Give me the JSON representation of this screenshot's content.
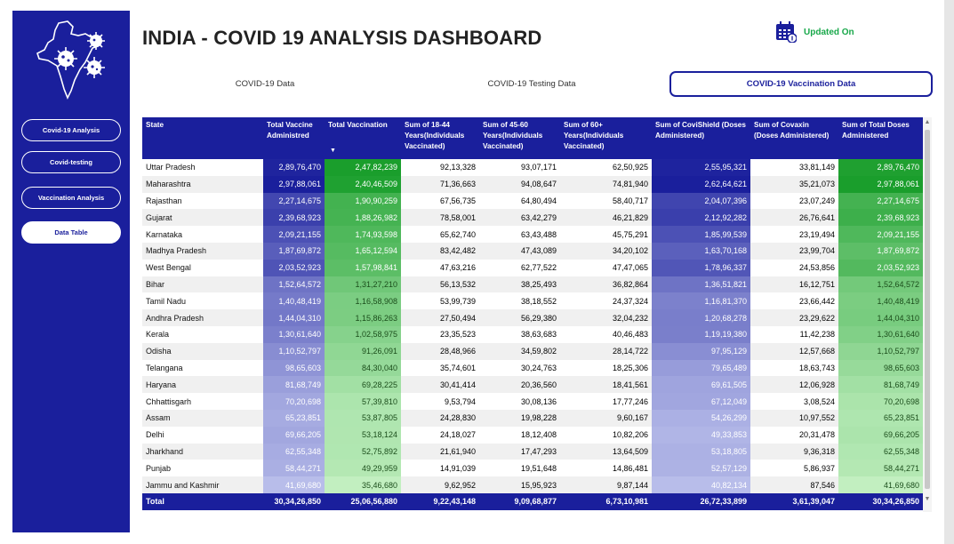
{
  "dashboard": {
    "title": "INDIA - COVID 19 ANALYSIS DASHBOARD",
    "updated_label": "Updated On",
    "calendar_icon": "calendar-icon",
    "logo_icon": "india-covid-virus-logo"
  },
  "sidebar": {
    "items": [
      {
        "label": "Covid-19 Analysis"
      },
      {
        "label": "Covid-testing"
      },
      {
        "label": "Vaccination Analysis"
      },
      {
        "label": "Data Table"
      }
    ]
  },
  "tabs": [
    {
      "label": "COVID-19 Data"
    },
    {
      "label": "COVID-19 Testing Data"
    },
    {
      "label": "COVID-19 Vaccination Data"
    }
  ],
  "table": {
    "headers": [
      "State",
      "Total Vaccine Administred",
      "Total Vaccination",
      "Sum of 18-44 Years(Individuals Vaccinated)",
      "Sum of 45-60 Years(Individuals Vaccinated)",
      "Sum of 60+ Years(Individuals Vaccinated)",
      "Sum of CoviShield (Doses Administered)",
      "Sum of Covaxin (Doses Administered)",
      "Sum of Total Doses Administered"
    ],
    "rows": [
      [
        "Uttar Pradesh",
        "2,89,76,470",
        "2,47,82,239",
        "92,13,328",
        "93,07,171",
        "62,50,925",
        "2,55,95,321",
        "33,81,149",
        "2,89,76,470"
      ],
      [
        "Maharashtra",
        "2,97,88,061",
        "2,40,46,509",
        "71,36,663",
        "94,08,647",
        "74,81,940",
        "2,62,64,621",
        "35,21,073",
        "2,97,88,061"
      ],
      [
        "Rajasthan",
        "2,27,14,675",
        "1,90,90,259",
        "67,56,735",
        "64,80,494",
        "58,40,717",
        "2,04,07,396",
        "23,07,249",
        "2,27,14,675"
      ],
      [
        "Gujarat",
        "2,39,68,923",
        "1,88,26,982",
        "78,58,001",
        "63,42,279",
        "46,21,829",
        "2,12,92,282",
        "26,76,641",
        "2,39,68,923"
      ],
      [
        "Karnataka",
        "2,09,21,155",
        "1,74,93,598",
        "65,62,740",
        "63,43,488",
        "45,75,291",
        "1,85,99,539",
        "23,19,494",
        "2,09,21,155"
      ],
      [
        "Madhya Pradesh",
        "1,87,69,872",
        "1,65,12,594",
        "83,42,482",
        "47,43,089",
        "34,20,102",
        "1,63,70,168",
        "23,99,704",
        "1,87,69,872"
      ],
      [
        "West Bengal",
        "2,03,52,923",
        "1,57,98,841",
        "47,63,216",
        "62,77,522",
        "47,47,065",
        "1,78,96,337",
        "24,53,856",
        "2,03,52,923"
      ],
      [
        "Bihar",
        "1,52,64,572",
        "1,31,27,210",
        "56,13,532",
        "38,25,493",
        "36,82,864",
        "1,36,51,821",
        "16,12,751",
        "1,52,64,572"
      ],
      [
        "Tamil Nadu",
        "1,40,48,419",
        "1,16,58,908",
        "53,99,739",
        "38,18,552",
        "24,37,324",
        "1,16,81,370",
        "23,66,442",
        "1,40,48,419"
      ],
      [
        "Andhra Pradesh",
        "1,44,04,310",
        "1,15,86,263",
        "27,50,494",
        "56,29,380",
        "32,04,232",
        "1,20,68,278",
        "23,29,622",
        "1,44,04,310"
      ],
      [
        "Kerala",
        "1,30,61,640",
        "1,02,58,975",
        "23,35,523",
        "38,63,683",
        "40,46,483",
        "1,19,19,380",
        "11,42,238",
        "1,30,61,640"
      ],
      [
        "Odisha",
        "1,10,52,797",
        "91,26,091",
        "28,48,966",
        "34,59,802",
        "28,14,722",
        "97,95,129",
        "12,57,668",
        "1,10,52,797"
      ],
      [
        "Telangana",
        "98,65,603",
        "84,30,040",
        "35,74,601",
        "30,24,763",
        "18,25,306",
        "79,65,489",
        "18,63,743",
        "98,65,603"
      ],
      [
        "Haryana",
        "81,68,749",
        "69,28,225",
        "30,41,414",
        "20,36,560",
        "18,41,561",
        "69,61,505",
        "12,06,928",
        "81,68,749"
      ],
      [
        "Chhattisgarh",
        "70,20,698",
        "57,39,810",
        "9,53,794",
        "30,08,136",
        "17,77,246",
        "67,12,049",
        "3,08,524",
        "70,20,698"
      ],
      [
        "Assam",
        "65,23,851",
        "53,87,805",
        "24,28,830",
        "19,98,228",
        "9,60,167",
        "54,26,299",
        "10,97,552",
        "65,23,851"
      ],
      [
        "Delhi",
        "69,66,205",
        "53,18,124",
        "24,18,027",
        "18,12,408",
        "10,82,206",
        "49,33,853",
        "20,31,478",
        "69,66,205"
      ],
      [
        "Jharkhand",
        "62,55,348",
        "52,75,892",
        "21,61,940",
        "17,47,293",
        "13,64,509",
        "53,18,805",
        "9,36,318",
        "62,55,348"
      ],
      [
        "Punjab",
        "58,44,271",
        "49,29,959",
        "14,91,039",
        "19,51,648",
        "14,86,481",
        "52,57,129",
        "5,86,937",
        "58,44,271"
      ],
      [
        "Jammu and Kashmir",
        "41,69,680",
        "35,46,680",
        "9,62,952",
        "15,95,923",
        "9,87,144",
        "40,82,134",
        "87,546",
        "41,69,680"
      ]
    ],
    "footer": [
      "Total",
      "30,34,26,850",
      "25,06,56,880",
      "9,22,43,148",
      "9,09,68,877",
      "6,73,10,981",
      "26,72,33,899",
      "3,61,39,047",
      "30,34,26,850"
    ],
    "colors": {
      "header": "#1a1f9c",
      "blue_scale": [
        "#1a1f9c",
        "#b8bdea"
      ],
      "green_scale": [
        "#1a9e2c",
        "#c2efc0"
      ]
    }
  }
}
